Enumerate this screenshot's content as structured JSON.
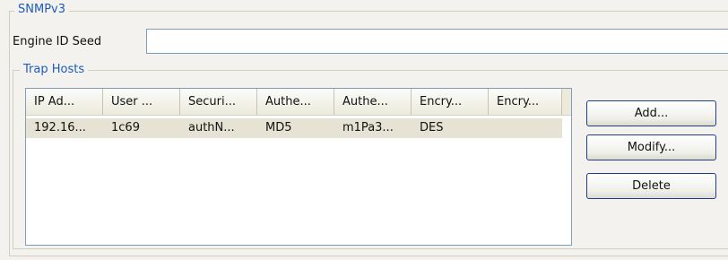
{
  "snmp_group": {
    "title": "SNMPv3"
  },
  "engine": {
    "label": "Engine ID Seed",
    "value": ""
  },
  "trap_hosts": {
    "title": "Trap Hosts",
    "columns": [
      "IP Ad...",
      "User ...",
      "Securi...",
      "Authe...",
      "Authe...",
      "Encry...",
      "Encry..."
    ],
    "rows": [
      [
        "192.16...",
        "1c69",
        "authN...",
        "MD5",
        "m1Pa3...",
        "DES",
        ""
      ]
    ]
  },
  "buttons": {
    "add": "Add...",
    "modify": "Modify...",
    "delete": "Delete"
  }
}
